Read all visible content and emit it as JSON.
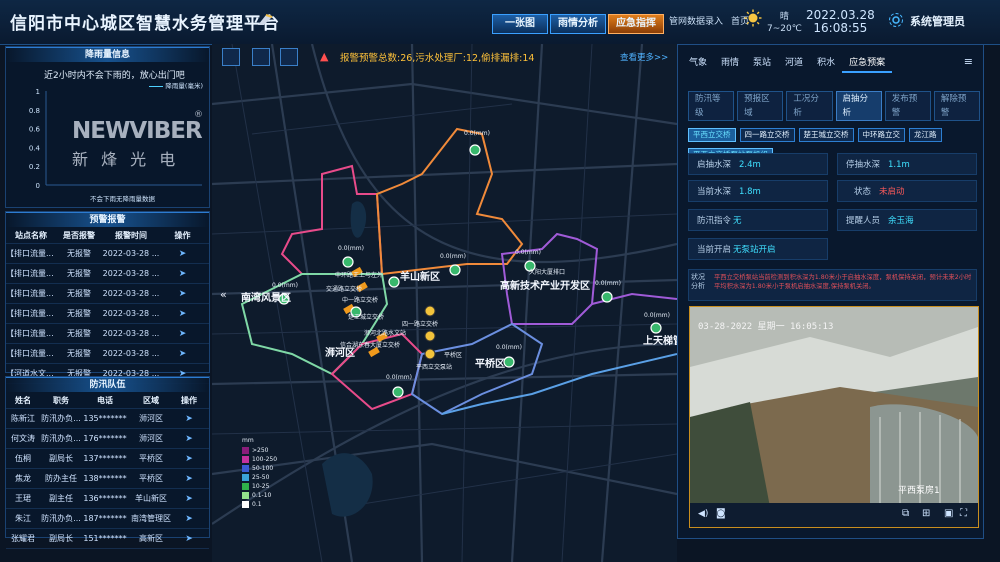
{
  "header": {
    "title": "信阳市中心城区智慧水务管理平台",
    "nav": [
      "一张图",
      "雨情分析",
      "应急指挥"
    ],
    "nav_active": 2,
    "login_link": "管网数据录入",
    "home": "首页",
    "weather": {
      "condition": "晴",
      "temp": "7~20℃",
      "icon": "sun-icon"
    },
    "date": "2022.03.28",
    "time": "16:08:55",
    "user": "系统管理员"
  },
  "rain_panel": {
    "title": "降雨量信息",
    "message": "近2小时内不会下雨的，放心出门吧",
    "legend": "降雨量(毫米)",
    "footer": "不会下雨无降雨量数据",
    "y_ticks": [
      "1",
      "0.8",
      "0.6",
      "0.4",
      "0.2",
      "0"
    ]
  },
  "chart_data": {
    "type": "line",
    "title": "",
    "ylabel": "",
    "xlabel": "不会下雨无降雨量数据",
    "ylim": [
      0,
      1
    ],
    "series": [
      {
        "name": "降雨量(毫米)",
        "values": []
      }
    ]
  },
  "watermark": {
    "brand": "NEWVIBER",
    "sub": "新 烽 光 电",
    "reg": "®"
  },
  "alert_panel": {
    "title": "预警报警",
    "headers": [
      "站点名称",
      "是否报警",
      "报警时间",
      "操作"
    ],
    "rows": [
      [
        "【排口流量...",
        "无报警",
        "2022-03-28 ..."
      ],
      [
        "【排口流量...",
        "无报警",
        "2022-03-28 ..."
      ],
      [
        "【排口流量...",
        "无报警",
        "2022-03-28 ..."
      ],
      [
        "【排口流量...",
        "无报警",
        "2022-03-28 ..."
      ],
      [
        "【排口流量...",
        "无报警",
        "2022-03-28 ..."
      ],
      [
        "【排口流量...",
        "无报警",
        "2022-03-28 ..."
      ],
      [
        "【河道水文...",
        "无报警",
        "2022-03-28 ..."
      ]
    ]
  },
  "team_panel": {
    "title": "防汛队伍",
    "headers": [
      "姓名",
      "职务",
      "电话",
      "区域",
      "操作"
    ],
    "rows": [
      [
        "陈新江",
        "防汛办负...",
        "135*******",
        "浉河区"
      ],
      [
        "何文涛",
        "防汛办负...",
        "176*******",
        "浉河区"
      ],
      [
        "伍桐",
        "副局长",
        "137*******",
        "平桥区"
      ],
      [
        "焦龙",
        "防办主任",
        "138*******",
        "平桥区"
      ],
      [
        "王珺",
        "副主任",
        "136*******",
        "羊山新区"
      ],
      [
        "朱江",
        "防汛办负...",
        "187*******",
        "南湾管理区"
      ],
      [
        "张耀君",
        "副局长",
        "151*******",
        "高新区"
      ]
    ]
  },
  "map": {
    "alarm_text": "报警预警总数:26,污水处理厂:12,偷排漏排:14",
    "more": "查看更多>>",
    "districts": [
      "羊山新区",
      "高新技术产业开发区",
      "南湾风景区",
      "浉河区",
      "平桥区",
      "上天梯管"
    ],
    "stations": [
      "中环路王上与左外",
      "交通路立交桥",
      "中一路立交桥",
      "四一路立交桥",
      "楚王城立交桥",
      "浉河北路水文站",
      "信合湖东春大厦立交桥",
      "平西立交泵站",
      "平桥区",
      "久阳大厦排口"
    ],
    "values": [
      "0.0(mm)"
    ],
    "legend": {
      "unit": "mm",
      "items": [
        ">250",
        "100-250",
        "50-100",
        "25-50",
        "10-25",
        "0.1-10",
        "0.1"
      ],
      "colors": [
        "#8a1d7a",
        "#c4319e",
        "#3a5bd4",
        "#3aa2d8",
        "#2fb24a",
        "#93e08b",
        "#ffffff"
      ]
    }
  },
  "right_panel": {
    "tabs": [
      "气象",
      "雨情",
      "泵站",
      "河道",
      "积水",
      "应急预案"
    ],
    "active_tab": 5,
    "subtabs": [
      "防汛等级",
      "预报区域",
      "工况分析",
      "启抽分析",
      "发布预警",
      "解除预警"
    ],
    "active_subtab": 3,
    "chips": [
      "平西立交桥",
      "四一路立交桥",
      "楚王城立交桥",
      "中环路立交",
      "龙江路",
      "平西立交桥泵站泵机组"
    ],
    "fields": {
      "start_depth_label": "启抽水深",
      "start_depth": "2.4m",
      "stop_depth_label": "停抽水深",
      "stop_depth": "1.1m",
      "current_depth_label": "当前水深",
      "current_depth": "1.8m",
      "status_label": "状态",
      "status": "未启动",
      "command_label": "防汛指令",
      "command": "无",
      "notifier_label": "提醒人员",
      "notifier": "余玉海",
      "current_open_label": "当前开启",
      "current_open": "无泵站开启",
      "analysis_label": "状况分析",
      "analysis": "平西立交桥泵站当前检测到积水深为1.80米小于启抽水深度，泵机保持关闭，预计未来2小时平均积水深为1.80米小于泵机启抽水深度,保持泵机关闭。"
    },
    "video": {
      "timestamp": "03-28-2022 星期一 16:05:13",
      "caption": "平西泵房1"
    }
  },
  "colors": {
    "accent": "#3aa0ff",
    "active": "#e07e1c",
    "cyan": "#3fe0ff",
    "alert": "#ff5a5a"
  }
}
